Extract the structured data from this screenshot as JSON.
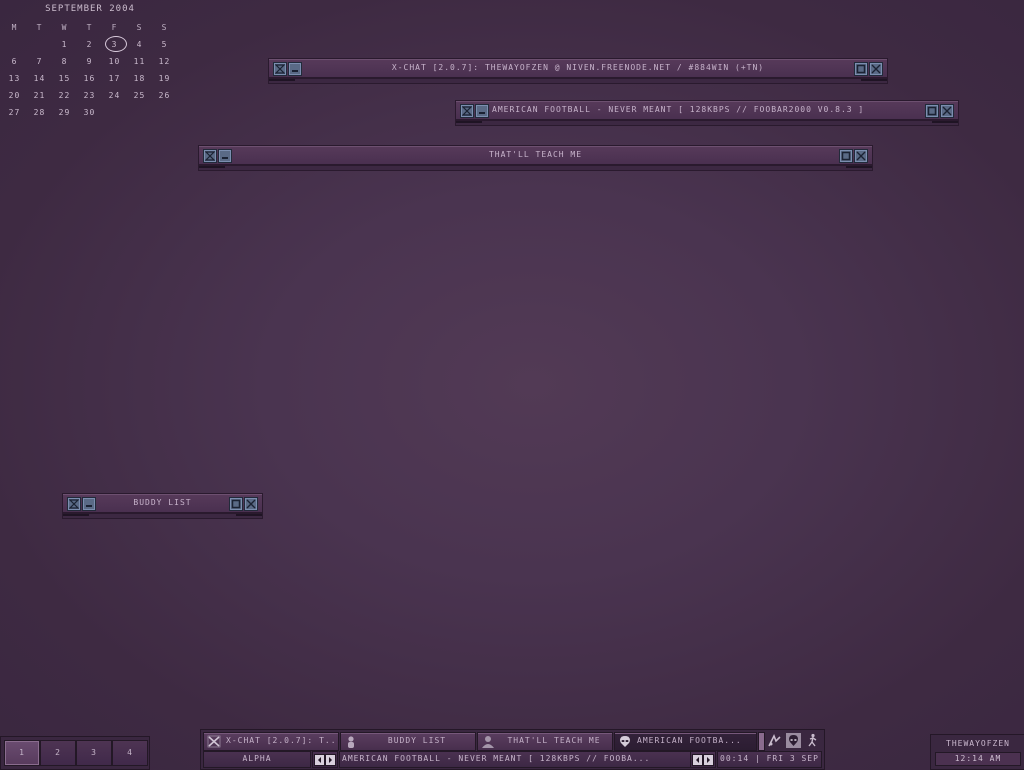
{
  "calendar": {
    "title": "SEPTEMBER 2004",
    "weekdays": [
      "M",
      "T",
      "W",
      "T",
      "F",
      "S",
      "S"
    ],
    "rows": [
      [
        "",
        "",
        "1",
        "2",
        "3",
        "4",
        "5"
      ],
      [
        "6",
        "7",
        "8",
        "9",
        "10",
        "11",
        "12"
      ],
      [
        "13",
        "14",
        "15",
        "16",
        "17",
        "18",
        "19"
      ],
      [
        "20",
        "21",
        "22",
        "23",
        "24",
        "25",
        "26"
      ],
      [
        "27",
        "28",
        "29",
        "30",
        "",
        "",
        ""
      ]
    ],
    "today": "3"
  },
  "windows": {
    "xchat": {
      "title": "X-CHAT [2.0.7]: THEWAYOFZEN @ NIVEN.FREENODE.NET / #884WIN (+TN)"
    },
    "foobar": {
      "title": "AMERICAN FOOTBALL -  NEVER MEANT  [ 128KBPS // FOOBAR2000 V0.8.3 ]"
    },
    "teach": {
      "title": "THAT'LL TEACH ME"
    },
    "buddy": {
      "title": "BUDDY LIST"
    }
  },
  "desktops": [
    "1",
    "2",
    "3",
    "4"
  ],
  "active_desktop": "1",
  "taskbar": {
    "tasks": [
      {
        "label": "X-CHAT [2.0.7]: T...",
        "icon": "xchat-icon"
      },
      {
        "label": "BUDDY LIST",
        "icon": "buddy-icon"
      },
      {
        "label": "THAT'LL TEACH ME",
        "icon": "person-icon"
      },
      {
        "label": "AMERICAN FOOTBA...",
        "icon": "alien-icon"
      }
    ],
    "tray_icons": [
      "mixer-icon",
      "alien-tray-icon",
      "runner-icon"
    ],
    "workspace_name": "ALPHA",
    "now_playing": "AMERICAN FOOTBALL -  NEVER MEANT  [ 128KBPS // FOOBA...",
    "clock_strip": "00:14 | FRI 3 SEP"
  },
  "clock": {
    "user": "THEWAYOFZEN",
    "time": "12:14 AM"
  },
  "colors": {
    "background": "#4a3450",
    "button": "#5a6a86",
    "text": "#c8b6cc"
  }
}
